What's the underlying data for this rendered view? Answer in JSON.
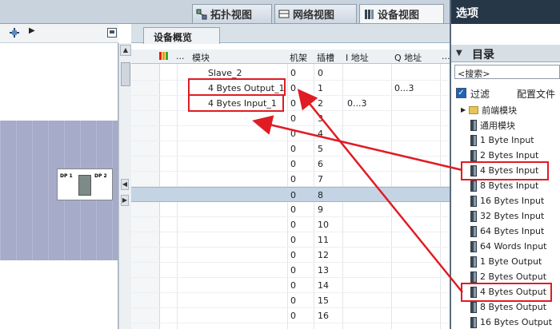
{
  "top_tabs": [
    {
      "label": "拓扑视图"
    },
    {
      "label": "网络视图"
    },
    {
      "label": "设备视图"
    }
  ],
  "right_header": {
    "title": "选项"
  },
  "overview": {
    "tab_label": "设备概览",
    "columns": {
      "module": "模块",
      "rack": "机架",
      "slot": "插槽",
      "i_addr": "I 地址",
      "q_addr": "Q 地址",
      "more": "..."
    },
    "rows": [
      {
        "module": "Slave_2",
        "rack": "0",
        "slot": "0",
        "i": "",
        "q": ""
      },
      {
        "module": "4 Bytes Output_1",
        "rack": "0",
        "slot": "1",
        "i": "",
        "q": "0...3"
      },
      {
        "module": "4 Bytes Input_1",
        "rack": "0",
        "slot": "2",
        "i": "0...3",
        "q": ""
      },
      {
        "module": "",
        "rack": "0",
        "slot": "3",
        "i": "",
        "q": ""
      },
      {
        "module": "",
        "rack": "0",
        "slot": "4",
        "i": "",
        "q": ""
      },
      {
        "module": "",
        "rack": "0",
        "slot": "5",
        "i": "",
        "q": ""
      },
      {
        "module": "",
        "rack": "0",
        "slot": "6",
        "i": "",
        "q": ""
      },
      {
        "module": "",
        "rack": "0",
        "slot": "7",
        "i": "",
        "q": ""
      },
      {
        "module": "",
        "rack": "0",
        "slot": "8",
        "i": "",
        "q": ""
      },
      {
        "module": "",
        "rack": "0",
        "slot": "9",
        "i": "",
        "q": ""
      },
      {
        "module": "",
        "rack": "0",
        "slot": "10",
        "i": "",
        "q": ""
      },
      {
        "module": "",
        "rack": "0",
        "slot": "11",
        "i": "",
        "q": ""
      },
      {
        "module": "",
        "rack": "0",
        "slot": "12",
        "i": "",
        "q": ""
      },
      {
        "module": "",
        "rack": "0",
        "slot": "13",
        "i": "",
        "q": ""
      },
      {
        "module": "",
        "rack": "0",
        "slot": "14",
        "i": "",
        "q": ""
      },
      {
        "module": "",
        "rack": "0",
        "slot": "15",
        "i": "",
        "q": ""
      },
      {
        "module": "",
        "rack": "0",
        "slot": "16",
        "i": "",
        "q": ""
      }
    ]
  },
  "device_graphic": {
    "dp1": "DP 1",
    "dp2": "DP 2"
  },
  "catalog": {
    "title": "目录",
    "search_value": "<搜索>",
    "filter_label": "过滤",
    "profile_label": "配置文件",
    "items": [
      {
        "label": "前端模块",
        "kind": "folder"
      },
      {
        "label": "通用模块",
        "kind": "module"
      },
      {
        "label": "1 Byte Input",
        "kind": "module"
      },
      {
        "label": "2 Bytes Input",
        "kind": "module"
      },
      {
        "label": "4 Bytes Input",
        "kind": "module"
      },
      {
        "label": "8 Bytes Input",
        "kind": "module"
      },
      {
        "label": "16 Bytes Input",
        "kind": "module"
      },
      {
        "label": "32 Bytes Input",
        "kind": "module"
      },
      {
        "label": "64 Bytes Input",
        "kind": "module"
      },
      {
        "label": "64 Words Input",
        "kind": "module"
      },
      {
        "label": "1 Byte Output",
        "kind": "module"
      },
      {
        "label": "2 Bytes Output",
        "kind": "module"
      },
      {
        "label": "4 Bytes Output",
        "kind": "module"
      },
      {
        "label": "8 Bytes Output",
        "kind": "module"
      },
      {
        "label": "16 Bytes Output",
        "kind": "module"
      }
    ]
  },
  "colors": {
    "annotation": "#e01b24",
    "header_dark": "#263748",
    "selection": "#c4d4e4"
  }
}
